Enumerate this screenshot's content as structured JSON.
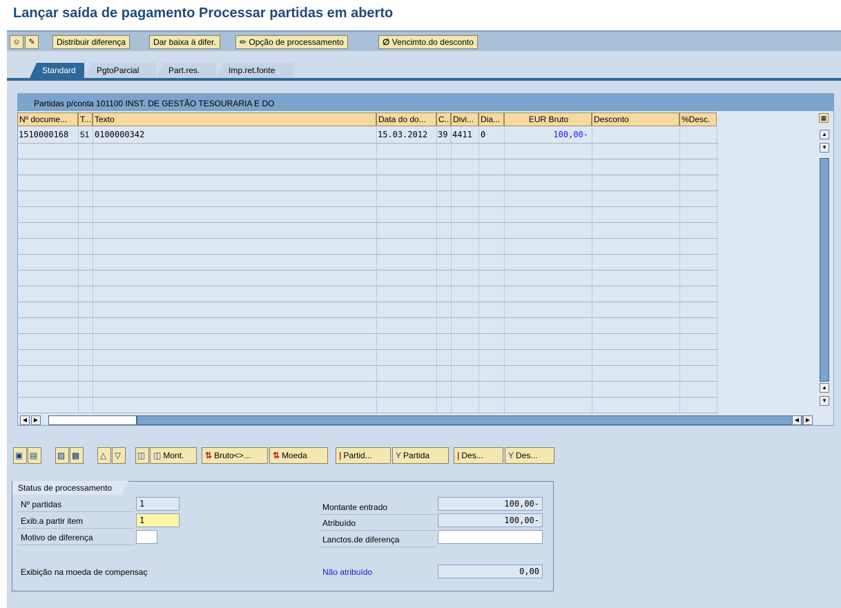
{
  "page_title": "Lançar saída de pagamento Processar partidas em aberto",
  "toolbar": {
    "buttons": [
      {
        "label": "Distribuir diferença"
      },
      {
        "label": "Dar baixa à difer."
      },
      {
        "label": "Opção de processamento",
        "icon": "pencil-icon"
      },
      {
        "label": "Vencimto.do desconto",
        "icon": "null-circle-icon"
      }
    ]
  },
  "tabs": [
    {
      "label": "Standard",
      "active": true
    },
    {
      "label": "PgtoParcial"
    },
    {
      "label": "Part.res."
    },
    {
      "label": "Imp.ret.fonte"
    }
  ],
  "table": {
    "caption": "Partidas p/conta 101100 INST. DE GESTÃO TESOURARIA E DO",
    "columns": [
      "Nº docume...",
      "T...",
      "Texto",
      "Data do do...",
      "C..",
      "Divi...",
      "Dia...",
      "EUR Bruto",
      "Desconto",
      "%Desc."
    ],
    "rows": [
      [
        "1510000168",
        "51",
        "0100000342",
        "15.03.2012",
        "39",
        "4411",
        "0",
        "100,00-",
        "",
        ""
      ]
    ]
  },
  "table_buttons": [
    {
      "label": "Mont."
    },
    {
      "label": "Bruto<>..."
    },
    {
      "label": "Moeda"
    },
    {
      "label": "Partid..."
    },
    {
      "label": "Partida"
    },
    {
      "label": "Des..."
    },
    {
      "label": "Des..."
    }
  ],
  "status": {
    "tab_label": "Status de processamento",
    "n_partidas_label": "Nº partidas",
    "n_partidas_value": "1",
    "exib_label": "Exib.a partir item",
    "exib_value": "1",
    "motivo_label": "Motivo de diferença",
    "motivo_value": "",
    "exibicao_label": "Exibição na moeda de compensaç",
    "montante_label": "Montante entrado",
    "montante_value": "100,00-",
    "atribuido_label": "Atribuído",
    "atribuido_value": "100,00-",
    "lanctos_label": "Lanctos.de diferença",
    "lanctos_value": "",
    "nao_atribuido_label": "Não atribuído",
    "nao_atribuido_value": "0,00"
  },
  "colors": {
    "accent": "#2d6a9a",
    "title": "#1f4b7a",
    "amount": "#1a1aff",
    "link": "#1a1ac8"
  }
}
